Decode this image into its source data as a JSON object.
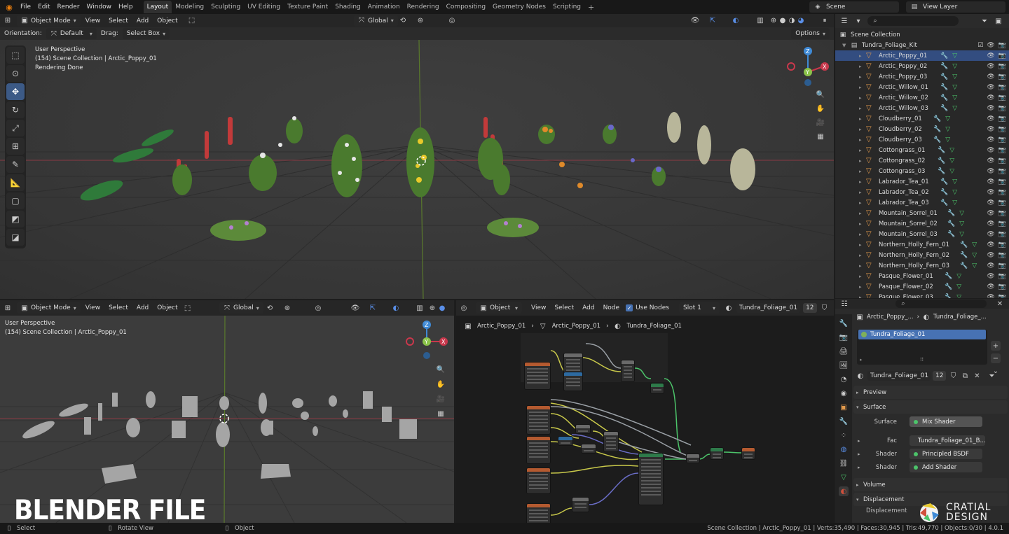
{
  "menu": {
    "items": [
      "File",
      "Edit",
      "Render",
      "Window",
      "Help"
    ],
    "workspaces": [
      "Layout",
      "Modeling",
      "Sculpting",
      "UV Editing",
      "Texture Paint",
      "Shading",
      "Animation",
      "Rendering",
      "Compositing",
      "Geometry Nodes",
      "Scripting"
    ],
    "active_workspace": "Layout",
    "add_tab": "+",
    "scene": "Scene",
    "view_layer": "View Layer"
  },
  "viewport_top": {
    "mode": "Object Mode",
    "menus": [
      "View",
      "Select",
      "Add",
      "Object"
    ],
    "transform_orientation": "Global",
    "orientation_label": "Orientation:",
    "orientation_value": "Default",
    "drag_label": "Drag:",
    "drag_value": "Select Box",
    "options": "Options",
    "overlay_lines": [
      "User Perspective",
      "(154) Scene Collection | Arctic_Poppy_01",
      "Rendering Done"
    ]
  },
  "viewport_bottom": {
    "mode": "Object Mode",
    "menus": [
      "View",
      "Select",
      "Add",
      "Object"
    ],
    "transform_orientation": "Global",
    "overlay_lines": [
      "User Perspective",
      "(154) Scene Collection | Arctic_Poppy_01"
    ]
  },
  "node_editor": {
    "type": "Object",
    "menus": [
      "View",
      "Select",
      "Add",
      "Node"
    ],
    "use_nodes": "Use Nodes",
    "slot": "Slot 1",
    "material": "Tundra_Foliage_01",
    "users": "12",
    "breadcrumb": [
      "Arctic_Poppy_01",
      "Arctic_Poppy_01",
      "Tundra_Foliage_01"
    ]
  },
  "outliner": {
    "search_placeholder": "",
    "root": "Scene Collection",
    "collection": "Tundra_Foliage_Kit",
    "objects": [
      "Arctic_Poppy_01",
      "Arctic_Poppy_02",
      "Arctic_Poppy_03",
      "Arctic_Willow_01",
      "Arctic_Willow_02",
      "Arctic_Willow_03",
      "Cloudberry_01",
      "Cloudberry_02",
      "Cloudberry_03",
      "Cottongrass_01",
      "Cottongrass_02",
      "Cottongrass_03",
      "Labrador_Tea_01",
      "Labrador_Tea_02",
      "Labrador_Tea_03",
      "Mountain_Sorrel_01",
      "Mountain_Sorrel_02",
      "Mountain_Sorrel_03",
      "Northern_Holly_Fern_01",
      "Northern_Holly_Fern_02",
      "Northern_Holly_Fern_03",
      "Pasque_Flower_01",
      "Pasque_Flower_02",
      "Pasque_Flower_03"
    ]
  },
  "properties": {
    "context_object": "Arctic_Poppy_...",
    "context_material": "Tundra_Foliage_...",
    "slot_item": "Tundra_Foliage_01",
    "material_name": "Tundra_Foliage_01",
    "users": "12",
    "sections": {
      "preview": "Preview",
      "surface": "Surface",
      "volume": "Volume",
      "displacement": "Displacement"
    },
    "surface_label": "Surface",
    "surface_value": "Mix Shader",
    "fac_label": "Fac",
    "fac_value": "Tundra_Foliage_01_B...",
    "shader1_label": "Shader",
    "shader1_value": "Principled BSDF",
    "shader2_label": "Shader",
    "shader2_value": "Add Shader",
    "displacement_sub": "Displacement"
  },
  "status": {
    "select": "Select",
    "rotate": "Rotate View",
    "object": "Object",
    "stats": "Scene Collection | Arctic_Poppy_01 | Verts:35,490 | Faces:30,945 | Tris:49,770 | Objects:0/30 | 4.0.1"
  },
  "watermark": {
    "title": "BLENDER FILE",
    "brand_line1": "CRATIAL",
    "brand_line2": "DESIGN"
  },
  "colors": {
    "accent": "#4772b3",
    "object_orange": "#e39a4c",
    "x_axis": "#c8384c",
    "y_axis": "#8bc34a",
    "z_axis": "#3f8ad6",
    "socket_green": "#4cc46a"
  }
}
